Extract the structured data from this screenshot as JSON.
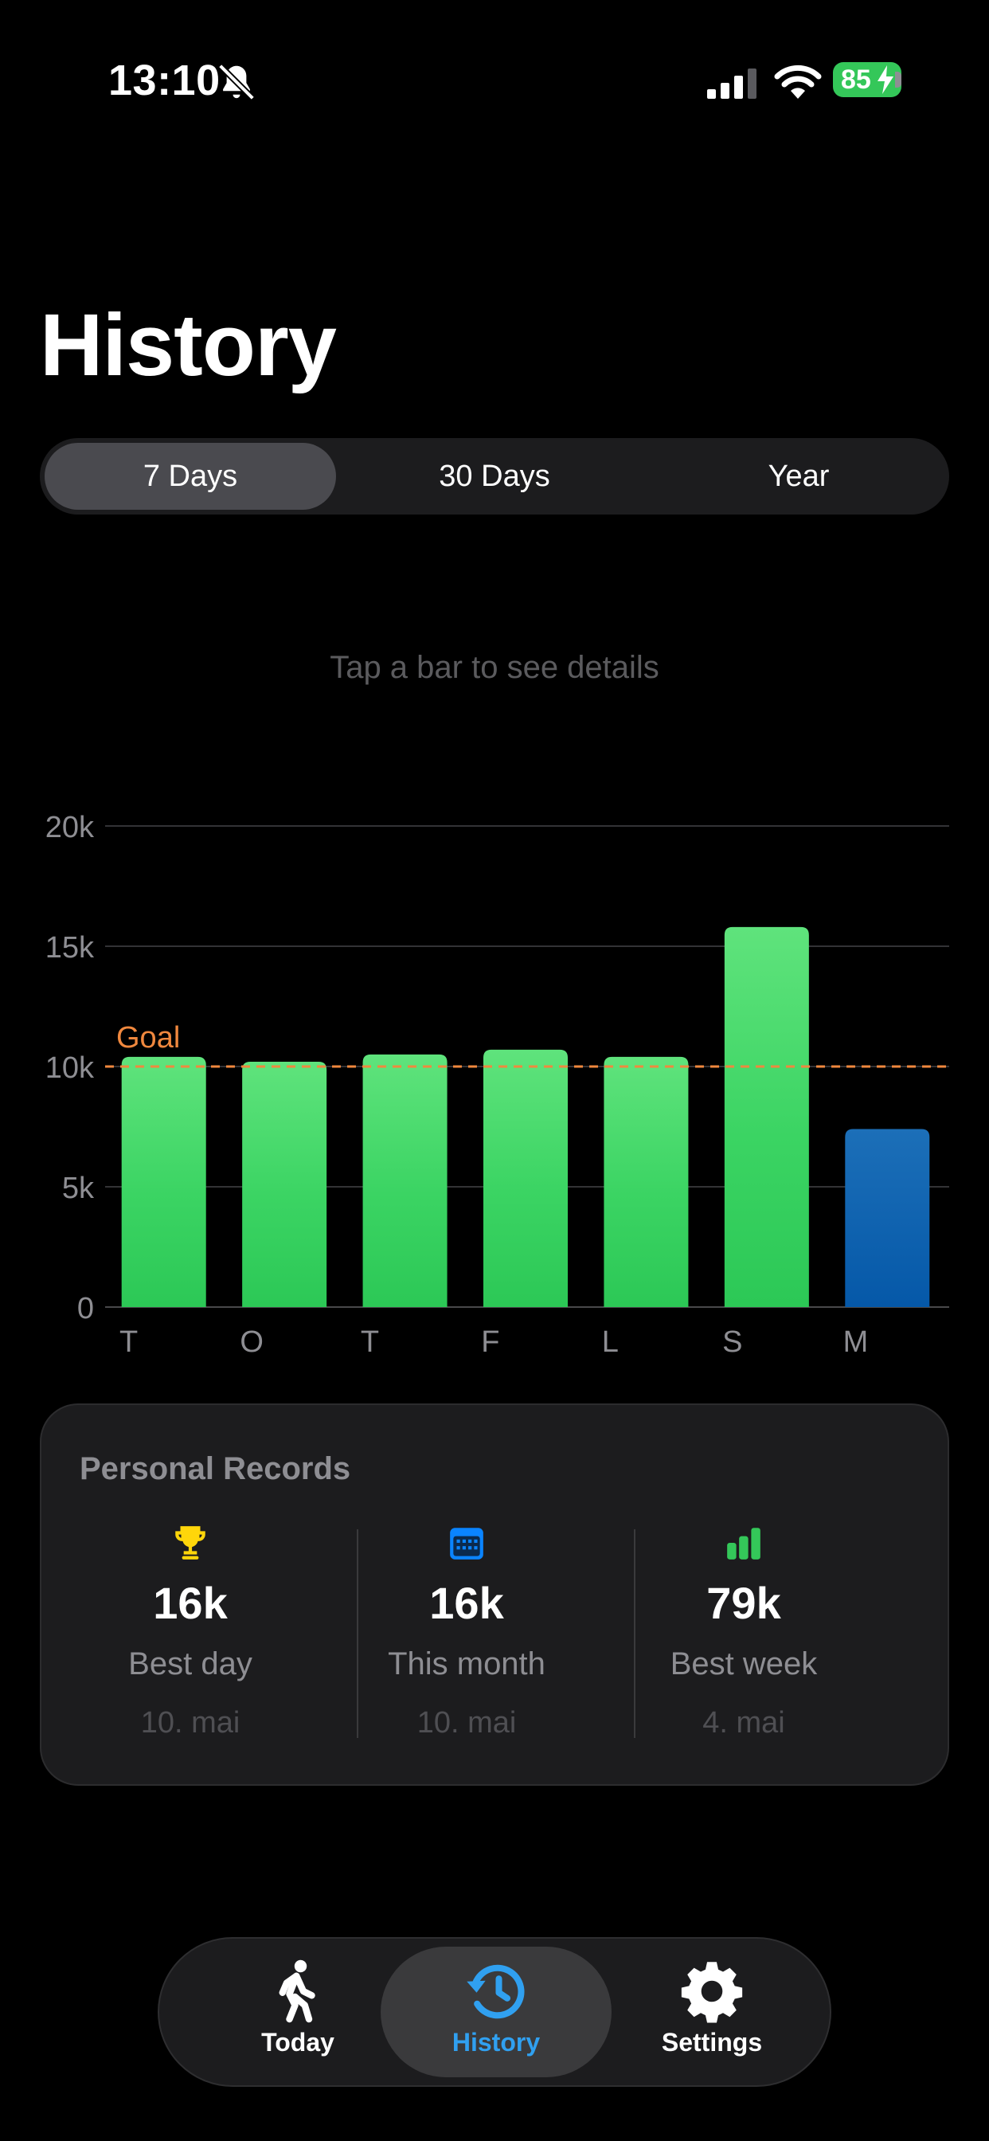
{
  "status": {
    "time": "13:10",
    "battery": "85"
  },
  "page": {
    "title": "History"
  },
  "segments": [
    {
      "label": "7 Days",
      "active": true
    },
    {
      "label": "30 Days",
      "active": false
    },
    {
      "label": "Year",
      "active": false
    }
  ],
  "hint": "Tap a bar to see details",
  "chart_data": {
    "type": "bar",
    "categories": [
      "T",
      "O",
      "T",
      "F",
      "L",
      "S",
      "M"
    ],
    "values": [
      10400,
      10200,
      10500,
      10700,
      10400,
      15800,
      7400
    ],
    "ylim": [
      0,
      20000
    ],
    "yticks": [
      {
        "value": 0,
        "label": "0"
      },
      {
        "value": 5000,
        "label": "5k"
      },
      {
        "value": 10000,
        "label": "10k"
      },
      {
        "value": 15000,
        "label": "15k"
      },
      {
        "value": 20000,
        "label": "20k"
      }
    ],
    "goal": {
      "value": 10000,
      "label": "Goal",
      "color": "#f0883e"
    },
    "bar_color": "#34c759",
    "highlight_color": "#0a60b0",
    "highlight_index": 6,
    "grid": true
  },
  "records": {
    "title": "Personal Records",
    "items": [
      {
        "icon": "trophy-icon",
        "value": "16k",
        "label": "Best day",
        "date": "10. mai",
        "color": "#ffd60a"
      },
      {
        "icon": "calendar-icon",
        "value": "16k",
        "label": "This month",
        "date": "10. mai",
        "color": "#0a84ff"
      },
      {
        "icon": "bar-chart-icon",
        "value": "79k",
        "label": "Best week",
        "date": "4. mai",
        "color": "#34c759"
      }
    ]
  },
  "tabs": [
    {
      "label": "Today",
      "icon": "walking-icon",
      "active": false
    },
    {
      "label": "History",
      "icon": "history-icon",
      "active": true
    },
    {
      "label": "Settings",
      "icon": "gear-icon",
      "active": false
    }
  ],
  "colors": {
    "accent": "#30a0f0",
    "background": "#000000",
    "card": "#1c1c1e"
  }
}
